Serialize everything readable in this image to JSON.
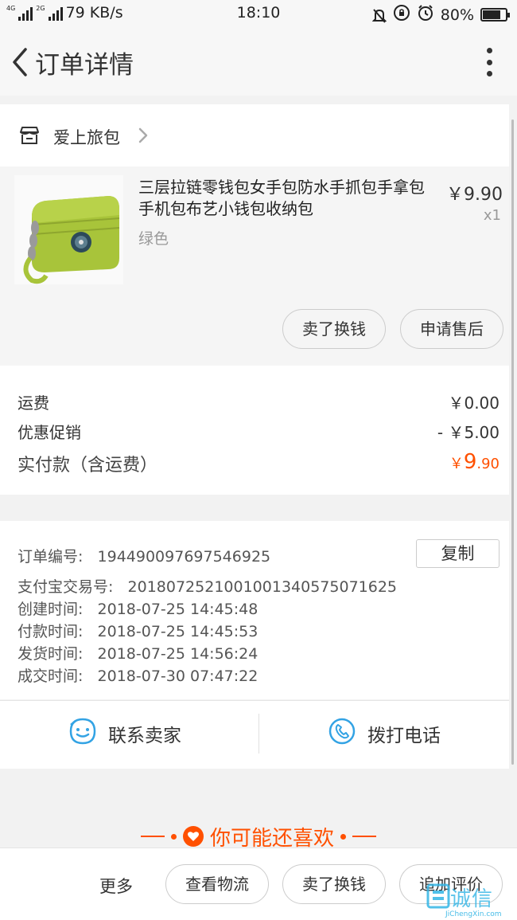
{
  "status_bar": {
    "network_1": "4G",
    "network_2": "2G",
    "speed": "79 KB/s",
    "time": "18:10",
    "battery": "80%",
    "battery_level": 0.8
  },
  "nav": {
    "title": "订单详情"
  },
  "shop": {
    "name": "爱上旅包"
  },
  "product": {
    "title": "三层拉链零钱包女手包防水手抓包手拿包手机包布艺小钱包收纳包",
    "variant": "绿色",
    "price": "￥9.90",
    "qty": "x1",
    "sell_button": "卖了换钱",
    "after_sale_button": "申请售后"
  },
  "fees": {
    "shipping_label": "运费",
    "shipping_value": "￥0.00",
    "discount_label": "优惠促销",
    "discount_value": "- ￥5.00",
    "paid_label": "实付款（含运费）",
    "paid_currency": "￥",
    "paid_integer": "9",
    "paid_decimal": ".90"
  },
  "order_info": {
    "order_no_label": "订单编号:",
    "order_no": "194490097697546925",
    "copy_button": "复制",
    "alipay_label": "支付宝交易号:",
    "alipay_no": "2018072521001001340575071625",
    "created_label": "创建时间:",
    "created": "2018-07-25 14:45:48",
    "paid_label": "付款时间:",
    "paid": "2018-07-25 14:45:53",
    "shipped_label": "发货时间:",
    "shipped": "2018-07-25 14:56:24",
    "completed_label": "成交时间:",
    "completed": "2018-07-30 07:47:22"
  },
  "contact": {
    "seller_label": "联系卖家",
    "call_label": "拨打电话"
  },
  "recommend": {
    "title": "你可能还喜欢"
  },
  "bottom_bar": {
    "more": "更多",
    "logistics": "查看物流",
    "sell": "卖了换钱",
    "add_review": "追加评价"
  },
  "watermark": {
    "text": "诚信",
    "sub": "JiChengXin.com"
  },
  "colors": {
    "accent": "#ff5000",
    "contact_blue": "#33a3e4",
    "product_green": "#a8c43a"
  }
}
